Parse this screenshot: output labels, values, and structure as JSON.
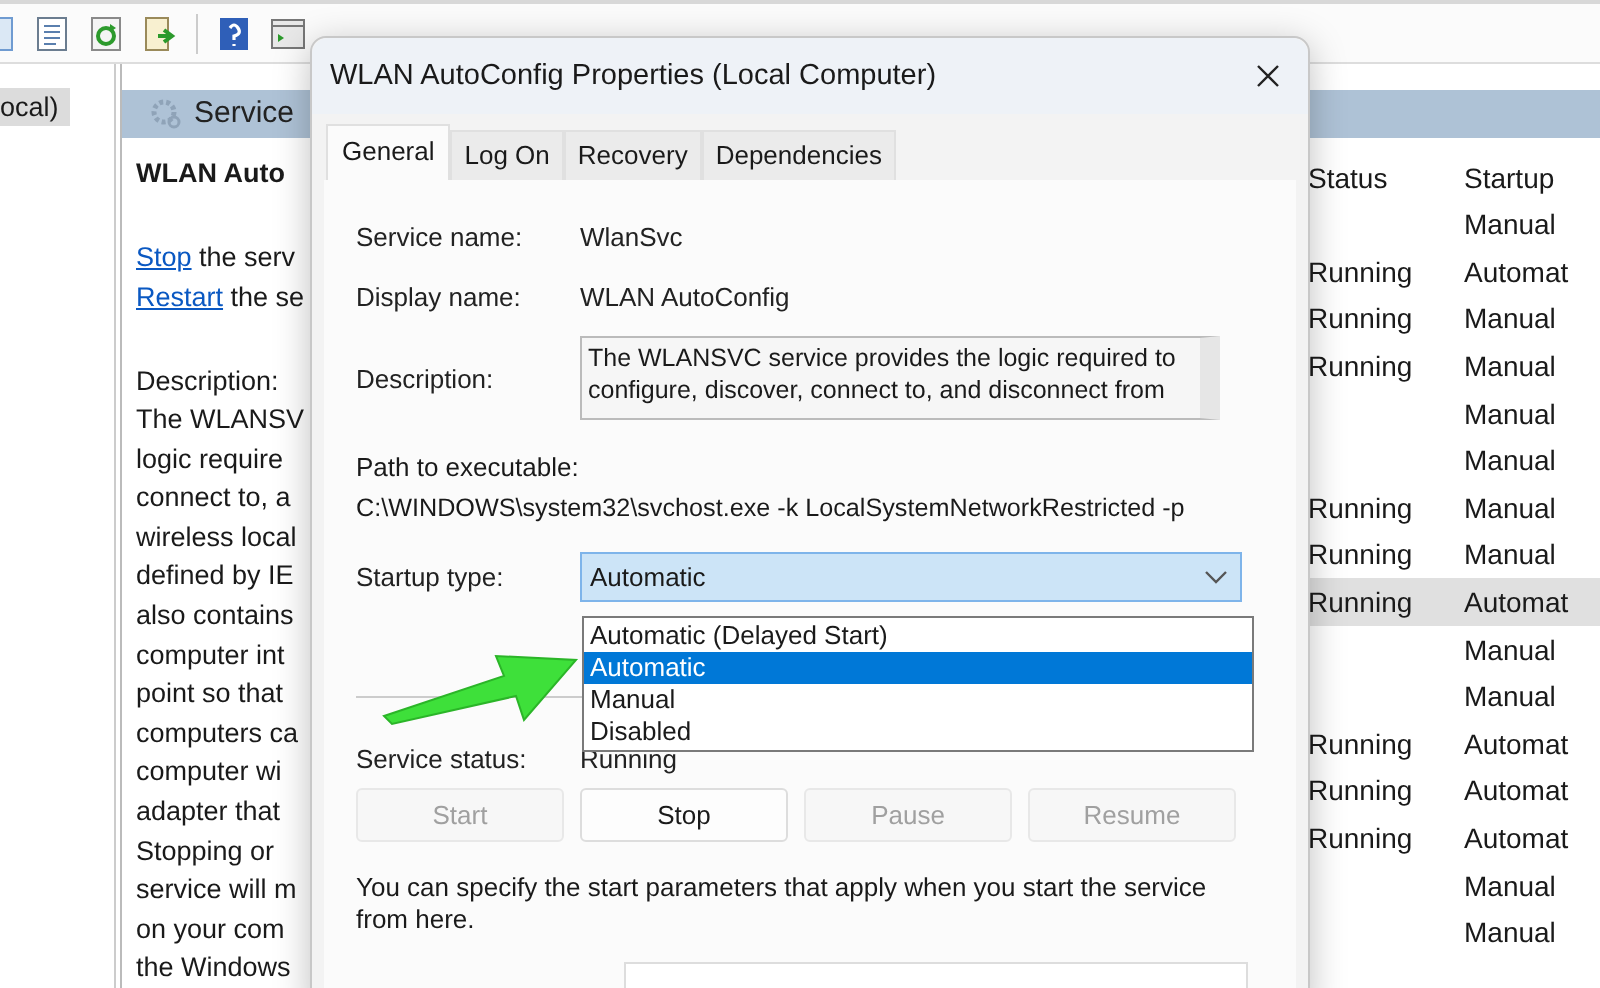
{
  "tree": {
    "items": [
      {
        "label": "ocal)",
        "selected": true
      }
    ]
  },
  "services_panel": {
    "header": "Service",
    "service_title": "WLAN Auto",
    "actions": [
      {
        "link": "Stop",
        "rest": "the serv"
      },
      {
        "link": "Restart",
        "rest": "the se"
      }
    ],
    "description_label": "Description:",
    "description_lines": [
      "The WLANSV",
      "logic require",
      "connect to, a",
      "wireless local",
      "defined by IE",
      "also contains",
      "computer int",
      "point so that",
      "computers ca",
      "computer wi",
      "adapter that",
      "Stopping or",
      "service will m",
      "on your com",
      "the Windows"
    ],
    "columns": [
      "Status",
      "Startup"
    ],
    "rows": [
      {
        "startup": "Manual",
        "selected": false
      },
      {
        "status": "Running",
        "startup": "Automat",
        "selected": false
      },
      {
        "status": "Running",
        "startup": "Manual",
        "selected": false
      },
      {
        "status": "Running",
        "startup": "Manual",
        "selected": false
      },
      {
        "startup": "Manual",
        "selected": false
      },
      {
        "startup": "Manual",
        "selected": false
      },
      {
        "status": "Running",
        "startup": "Manual",
        "selected": false
      },
      {
        "status": "Running",
        "startup": "Manual",
        "selected": false
      },
      {
        "status": "Running",
        "startup": "Automat",
        "selected": true
      },
      {
        "startup": "Manual",
        "selected": false
      },
      {
        "startup": "Manual",
        "selected": false
      },
      {
        "status": "Running",
        "startup": "Automat",
        "selected": false
      },
      {
        "status": "Running",
        "startup": "Automat",
        "selected": false
      },
      {
        "status": "Running",
        "startup": "Automat",
        "selected": false
      },
      {
        "startup": "Manual",
        "selected": false
      },
      {
        "startup": "Manual",
        "selected": false
      }
    ]
  },
  "dialog": {
    "title": "WLAN AutoConfig Properties (Local Computer)",
    "tabs": [
      {
        "label": "General",
        "selected": true
      },
      {
        "label": "Log On",
        "selected": false
      },
      {
        "label": "Recovery",
        "selected": false
      },
      {
        "label": "Dependencies",
        "selected": false
      }
    ],
    "fields": [
      {
        "label": "Service name:",
        "value": "WlanSvc"
      },
      {
        "label": "Display name:",
        "value": "WLAN AutoConfig"
      }
    ],
    "description": {
      "label": "Description:",
      "lines": [
        "The WLANSVC service provides the logic required to",
        "configure, discover, connect to, and disconnect from"
      ]
    },
    "path": {
      "label": "Path to executable:",
      "value": "C:\\WINDOWS\\system32\\svchost.exe -k LocalSystemNetworkRestricted -p"
    },
    "startup": {
      "label": "Startup type:",
      "value": "Automatic",
      "expanded": true,
      "options": [
        {
          "label": "Automatic (Delayed Start)",
          "selected": false
        },
        {
          "label": "Automatic",
          "selected": true
        },
        {
          "label": "Manual",
          "selected": false
        },
        {
          "label": "Disabled",
          "selected": false
        }
      ]
    },
    "status": {
      "label": "Service status:",
      "value": "Running"
    },
    "buttons": [
      {
        "label": "Start",
        "disabled": true
      },
      {
        "label": "Stop",
        "disabled": false
      },
      {
        "label": "Pause",
        "disabled": true
      },
      {
        "label": "Resume",
        "disabled": true
      }
    ],
    "hint": "You can specify the start parameters that apply when you start the service from here."
  }
}
